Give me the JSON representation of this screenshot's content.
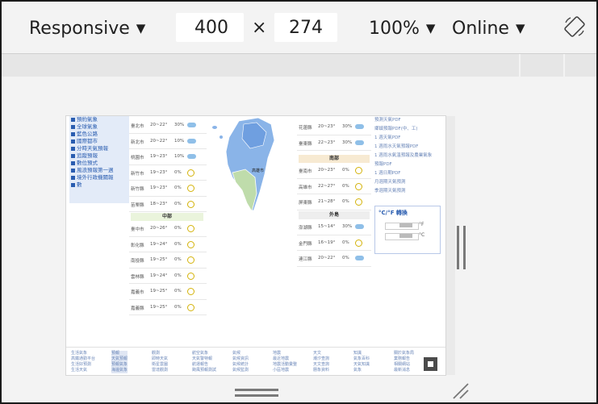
{
  "toolbar": {
    "device": "Responsive",
    "width": "400",
    "times": "×",
    "height": "274",
    "zoom": "100%",
    "throttle": "Online",
    "caret": "▼"
  },
  "icons": {
    "rotate": "rotate-icon",
    "home": "home-icon"
  },
  "page": {
    "sidebar": [
      "預約氣象",
      "全球氣象",
      "藍色公路",
      "國際都市",
      "分時天氣預報",
      "追蹤預報",
      "數位預式",
      "風浪預報第一週",
      "境外行政機關報",
      "數"
    ],
    "north_rows": [
      {
        "city": "臺北市",
        "temp": "20~22°",
        "rain": "30%",
        "w": "cloud"
      },
      {
        "city": "新北市",
        "temp": "20~22°",
        "rain": "10%",
        "w": "cloud"
      },
      {
        "city": "桃園市",
        "temp": "19~23°",
        "rain": "10%",
        "w": "cloud"
      },
      {
        "city": "新竹市",
        "temp": "19~23°",
        "rain": "0%",
        "w": "sun"
      },
      {
        "city": "新竹縣",
        "temp": "19~23°",
        "rain": "0%",
        "w": "sun"
      },
      {
        "city": "苗栗縣",
        "temp": "18~23°",
        "rain": "0%",
        "w": "sun"
      }
    ],
    "central_title": "中部",
    "central_rows": [
      {
        "city": "臺中市",
        "temp": "20~26°",
        "rain": "0%",
        "w": "sun"
      },
      {
        "city": "彰化縣",
        "temp": "19~24°",
        "rain": "0%",
        "w": "sun"
      },
      {
        "city": "南投縣",
        "temp": "19~25°",
        "rain": "0%",
        "w": "sun"
      },
      {
        "city": "雲林縣",
        "temp": "19~24°",
        "rain": "0%",
        "w": "sun"
      },
      {
        "city": "嘉義市",
        "temp": "19~25°",
        "rain": "0%",
        "w": "sun"
      },
      {
        "city": "嘉義縣",
        "temp": "19~25°",
        "rain": "0%",
        "w": "sun"
      }
    ],
    "east_rows": [
      {
        "city": "花蓮縣",
        "temp": "20~23°",
        "rain": "30%",
        "w": "cloud"
      },
      {
        "city": "臺東縣",
        "temp": "22~23°",
        "rain": "30%",
        "w": "cloud"
      }
    ],
    "south_title": "南部",
    "south_rows": [
      {
        "city": "臺南市",
        "temp": "20~23°",
        "rain": "0%",
        "w": "sun"
      },
      {
        "city": "高雄市",
        "temp": "22~27°",
        "rain": "0%",
        "w": "sun"
      },
      {
        "city": "屏東縣",
        "temp": "21~28°",
        "rain": "0%",
        "w": "sun"
      }
    ],
    "island_title": "外島",
    "island_rows": [
      {
        "city": "澎湖縣",
        "temp": "15~14°",
        "rain": "30%",
        "w": "cloud"
      },
      {
        "city": "金門縣",
        "temp": "16~19°",
        "rain": "0%",
        "w": "sun"
      },
      {
        "city": "連江縣",
        "temp": "20~22°",
        "rain": "0%",
        "w": "cloud"
      }
    ],
    "map_label": "高雄市",
    "links": [
      "預測天氣PDF",
      "鄉鎮預報PDF(中、工)",
      "1 週天氣PDF",
      "1 週雨水天氣預報PDF",
      "1 週雨水氣溫預報及農業氣象",
      "預報PDF",
      "1 週日期PDF",
      "月週期天氣預測",
      "季週期天氣預測"
    ],
    "converter": {
      "title": "°C/°F 轉換",
      "unit_f": "°F",
      "unit_c": "°C"
    },
    "footer_cols": [
      [
        "生活氣象",
        "高鐵通勤平台",
        "生活好預測",
        "生活天氣"
      ],
      [
        "預報",
        "天氣預報",
        "預報氣象",
        "海邊氣象"
      ],
      [
        "觀測",
        "即時天氣",
        "衛星雲圖",
        "雷達觀測"
      ],
      [
        "航空氣象",
        "天氣警特報",
        "航運報告",
        "颱風預報測試"
      ],
      [
        "氣候",
        "氣候資訊",
        "氣候統計",
        "氣候監測"
      ],
      [
        "地震",
        "最近地震",
        "地震活動彙整",
        "小區地震"
      ],
      [
        "天文",
        "潮汐查詢",
        "天文查詢",
        "曆象資料"
      ],
      [
        "知識",
        "氣象百科",
        "天氣知識",
        "氣象"
      ],
      [
        "關於氣象局",
        "業務報告",
        "相關網站",
        "最新消息"
      ]
    ]
  }
}
